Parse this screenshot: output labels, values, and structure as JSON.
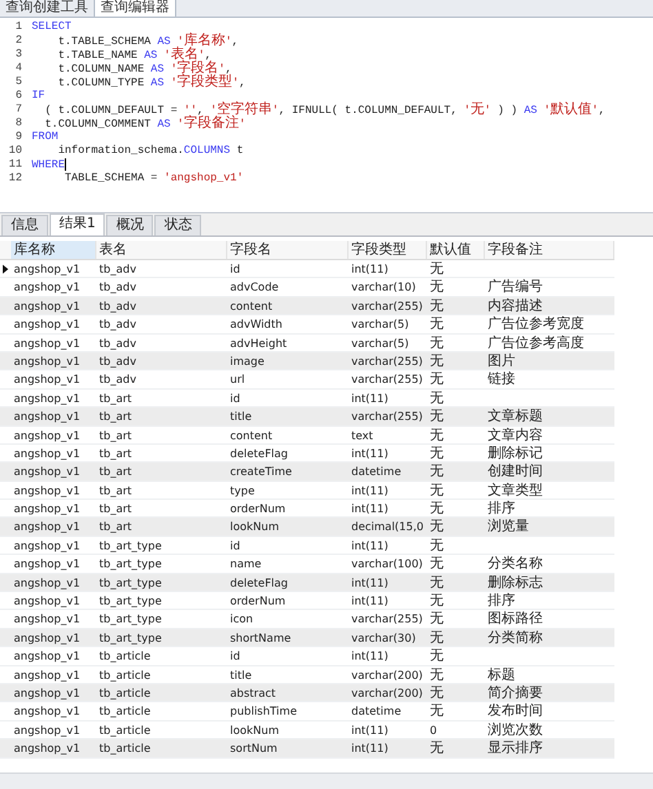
{
  "top_tabs": [
    {
      "label": "查询创建工具",
      "selected": false
    },
    {
      "label": "查询编辑器",
      "selected": true
    }
  ],
  "editor": {
    "lines": [
      {
        "number": "1",
        "tokens": [
          {
            "kind": "kw",
            "text": "SELECT"
          }
        ]
      },
      {
        "number": "2",
        "tokens": [
          {
            "kind": "plain",
            "text": "    t.TABLE_SCHEMA "
          },
          {
            "kind": "kw",
            "text": "AS "
          },
          {
            "kind": "str",
            "text": "'库名称'"
          },
          {
            "kind": "plain",
            "text": ","
          }
        ]
      },
      {
        "number": "3",
        "tokens": [
          {
            "kind": "plain",
            "text": "    t.TABLE_NAME "
          },
          {
            "kind": "kw",
            "text": "AS "
          },
          {
            "kind": "str",
            "text": "'表名'"
          },
          {
            "kind": "plain",
            "text": ","
          }
        ]
      },
      {
        "number": "4",
        "tokens": [
          {
            "kind": "plain",
            "text": "    t.COLUMN_NAME "
          },
          {
            "kind": "kw",
            "text": "AS "
          },
          {
            "kind": "str",
            "text": "'字段名'"
          },
          {
            "kind": "plain",
            "text": ","
          }
        ]
      },
      {
        "number": "5",
        "tokens": [
          {
            "kind": "plain",
            "text": "    t.COLUMN_TYPE "
          },
          {
            "kind": "kw",
            "text": "AS "
          },
          {
            "kind": "str",
            "text": "'字段类型'"
          },
          {
            "kind": "plain",
            "text": ","
          }
        ]
      },
      {
        "number": "6",
        "tokens": [
          {
            "kind": "kw",
            "text": "IF"
          }
        ]
      },
      {
        "number": "7",
        "tokens": [
          {
            "kind": "plain",
            "text": "  ( t.COLUMN_DEFAULT = "
          },
          {
            "kind": "str",
            "text": "''"
          },
          {
            "kind": "plain",
            "text": ", "
          },
          {
            "kind": "str",
            "text": "'空字符串'"
          },
          {
            "kind": "plain",
            "text": ", IFNULL( t.COLUMN_DEFAULT, "
          },
          {
            "kind": "str",
            "text": "'无'"
          },
          {
            "kind": "plain",
            "text": " ) ) "
          },
          {
            "kind": "kw",
            "text": "AS "
          },
          {
            "kind": "str",
            "text": "'默认值'"
          },
          {
            "kind": "plain",
            "text": ","
          }
        ]
      },
      {
        "number": "8",
        "tokens": [
          {
            "kind": "plain",
            "text": "  t.COLUMN_COMMENT "
          },
          {
            "kind": "kw",
            "text": "AS "
          },
          {
            "kind": "str",
            "text": "'字段备注'"
          }
        ]
      },
      {
        "number": "9",
        "tokens": [
          {
            "kind": "kw",
            "text": "FROM"
          }
        ]
      },
      {
        "number": "10",
        "tokens": [
          {
            "kind": "plain",
            "text": "    information_schema."
          },
          {
            "kind": "kw",
            "text": "COLUMNS"
          },
          {
            "kind": "plain",
            "text": " t"
          }
        ]
      },
      {
        "number": "11",
        "tokens": [
          {
            "kind": "kw",
            "text": "WHERE"
          }
        ],
        "cursor": true
      },
      {
        "number": "12",
        "tokens": [
          {
            "kind": "plain",
            "text": "     TABLE_SCHEMA = "
          },
          {
            "kind": "str",
            "text": "'angshop_v1'"
          }
        ]
      }
    ]
  },
  "result_tabs": [
    {
      "label": "信息",
      "selected": false
    },
    {
      "label": "结果1",
      "selected": true
    },
    {
      "label": "概况",
      "selected": false
    },
    {
      "label": "状态",
      "selected": false
    }
  ],
  "table": {
    "columns": [
      "库名称",
      "表名",
      "字段名",
      "字段类型",
      "默认值",
      "字段备注"
    ],
    "rows": [
      {
        "selected": true,
        "shaded": false,
        "cells": [
          "angshop_v1",
          "tb_adv",
          "id",
          "int(11)",
          "无",
          ""
        ]
      },
      {
        "selected": false,
        "shaded": false,
        "cells": [
          "angshop_v1",
          "tb_adv",
          "advCode",
          "varchar(10)",
          "无",
          "广告编号"
        ]
      },
      {
        "selected": false,
        "shaded": true,
        "cells": [
          "angshop_v1",
          "tb_adv",
          "content",
          "varchar(255)",
          "无",
          "内容描述"
        ]
      },
      {
        "selected": false,
        "shaded": false,
        "cells": [
          "angshop_v1",
          "tb_adv",
          "advWidth",
          "varchar(5)",
          "无",
          "广告位参考宽度"
        ]
      },
      {
        "selected": false,
        "shaded": false,
        "cells": [
          "angshop_v1",
          "tb_adv",
          "advHeight",
          "varchar(5)",
          "无",
          "广告位参考高度"
        ]
      },
      {
        "selected": false,
        "shaded": true,
        "cells": [
          "angshop_v1",
          "tb_adv",
          "image",
          "varchar(255)",
          "无",
          "图片"
        ]
      },
      {
        "selected": false,
        "shaded": false,
        "cells": [
          "angshop_v1",
          "tb_adv",
          "url",
          "varchar(255)",
          "无",
          "链接"
        ]
      },
      {
        "selected": false,
        "shaded": false,
        "cells": [
          "angshop_v1",
          "tb_art",
          "id",
          "int(11)",
          "无",
          ""
        ]
      },
      {
        "selected": false,
        "shaded": true,
        "cells": [
          "angshop_v1",
          "tb_art",
          "title",
          "varchar(255)",
          "无",
          "文章标题"
        ]
      },
      {
        "selected": false,
        "shaded": false,
        "cells": [
          "angshop_v1",
          "tb_art",
          "content",
          "text",
          "无",
          "文章内容"
        ]
      },
      {
        "selected": false,
        "shaded": false,
        "cells": [
          "angshop_v1",
          "tb_art",
          "deleteFlag",
          "int(11)",
          "无",
          "删除标记"
        ]
      },
      {
        "selected": false,
        "shaded": true,
        "cells": [
          "angshop_v1",
          "tb_art",
          "createTime",
          "datetime",
          "无",
          "创建时间"
        ]
      },
      {
        "selected": false,
        "shaded": false,
        "cells": [
          "angshop_v1",
          "tb_art",
          "type",
          "int(11)",
          "无",
          "文章类型"
        ]
      },
      {
        "selected": false,
        "shaded": false,
        "cells": [
          "angshop_v1",
          "tb_art",
          "orderNum",
          "int(11)",
          "无",
          "排序"
        ]
      },
      {
        "selected": false,
        "shaded": true,
        "cells": [
          "angshop_v1",
          "tb_art",
          "lookNum",
          "decimal(15,0",
          "无",
          "浏览量"
        ]
      },
      {
        "selected": false,
        "shaded": false,
        "cells": [
          "angshop_v1",
          "tb_art_type",
          "id",
          "int(11)",
          "无",
          ""
        ]
      },
      {
        "selected": false,
        "shaded": false,
        "cells": [
          "angshop_v1",
          "tb_art_type",
          "name",
          "varchar(100)",
          "无",
          "分类名称"
        ]
      },
      {
        "selected": false,
        "shaded": true,
        "cells": [
          "angshop_v1",
          "tb_art_type",
          "deleteFlag",
          "int(11)",
          "无",
          "删除标志"
        ]
      },
      {
        "selected": false,
        "shaded": false,
        "cells": [
          "angshop_v1",
          "tb_art_type",
          "orderNum",
          "int(11)",
          "无",
          "排序"
        ]
      },
      {
        "selected": false,
        "shaded": false,
        "cells": [
          "angshop_v1",
          "tb_art_type",
          "icon",
          "varchar(255)",
          "无",
          "图标路径"
        ]
      },
      {
        "selected": false,
        "shaded": true,
        "cells": [
          "angshop_v1",
          "tb_art_type",
          "shortName",
          "varchar(30)",
          "无",
          "分类简称"
        ]
      },
      {
        "selected": false,
        "shaded": false,
        "cells": [
          "angshop_v1",
          "tb_article",
          "id",
          "int(11)",
          "无",
          ""
        ]
      },
      {
        "selected": false,
        "shaded": false,
        "cells": [
          "angshop_v1",
          "tb_article",
          "title",
          "varchar(200)",
          "无",
          "标题"
        ]
      },
      {
        "selected": false,
        "shaded": true,
        "cells": [
          "angshop_v1",
          "tb_article",
          "abstract",
          "varchar(200)",
          "无",
          "简介摘要"
        ]
      },
      {
        "selected": false,
        "shaded": false,
        "cells": [
          "angshop_v1",
          "tb_article",
          "publishTime",
          "datetime",
          "无",
          "发布时间"
        ]
      },
      {
        "selected": false,
        "shaded": false,
        "cells": [
          "angshop_v1",
          "tb_article",
          "lookNum",
          "int(11)",
          "0",
          "浏览次数"
        ]
      },
      {
        "selected": false,
        "shaded": true,
        "cells": [
          "angshop_v1",
          "tb_article",
          "sortNum",
          "int(11)",
          "无",
          "显示排序"
        ]
      }
    ]
  }
}
